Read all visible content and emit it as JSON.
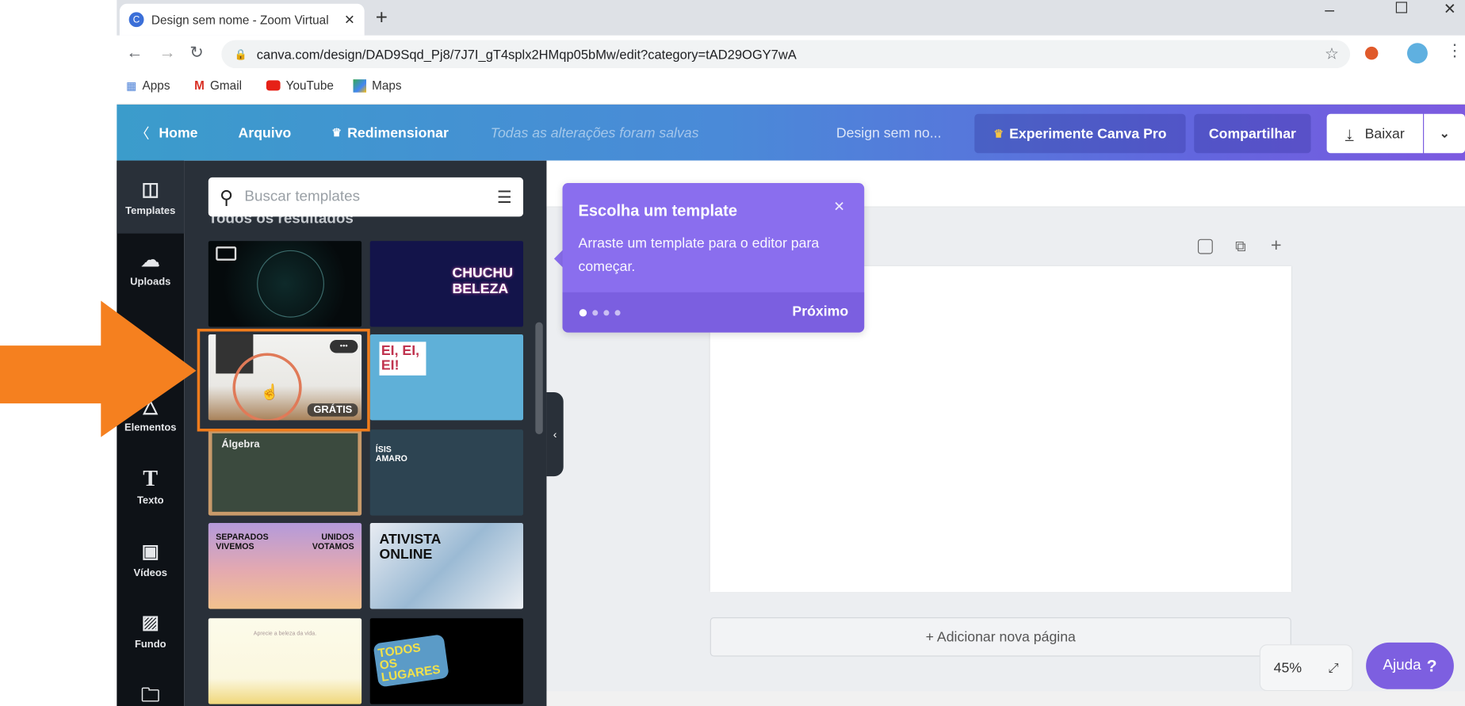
{
  "browser": {
    "tab_title": "Design sem nome - Zoom Virtual",
    "favicon_letter": "C",
    "new_tab": "+",
    "url": "canva.com/design/DAD9Sqd_Pj8/7J7I_gT4splx2HMqp05bMw/edit?category=tAD29OGY7wA",
    "bookmarks": [
      "Apps",
      "Gmail",
      "YouTube",
      "Maps"
    ]
  },
  "header": {
    "home": "Home",
    "file": "Arquivo",
    "resize": "Redimensionar",
    "status": "Todas as alterações foram salvas",
    "design_name": "Design sem no...",
    "pro": "Experimente Canva Pro",
    "share": "Compartilhar",
    "download": "Baixar"
  },
  "rail": [
    {
      "label": "Templates",
      "icon": "template-icon"
    },
    {
      "label": "Uploads",
      "icon": "upload-cloud-icon"
    },
    {
      "label": "Elementos",
      "icon": "elements-icon"
    },
    {
      "label": "Texto",
      "icon": "text-icon"
    },
    {
      "label": "Vídeos",
      "icon": "video-icon"
    },
    {
      "label": "Fundo",
      "icon": "background-icon"
    },
    {
      "label": "",
      "icon": "folder-icon"
    }
  ],
  "panel": {
    "search_placeholder": "Buscar templates",
    "heading": "Todos os resultados",
    "templates": [
      {
        "text": ""
      },
      {
        "text": "CHUCHU BELEZA"
      },
      {
        "text": "",
        "badge": "GRÁTIS",
        "more": "•••"
      },
      {
        "text": "EI, EI, EI!"
      },
      {
        "text": "Álgebra"
      },
      {
        "text": "ÍSIS AMARO"
      },
      {
        "text": "SEPARADOS VIVEMOS",
        "text2": "UNIDOS VOTAMOS"
      },
      {
        "text": "ATIVISTA ONLINE"
      },
      {
        "text": "Aprecie a beleza da vida."
      },
      {
        "text": "TODOS OS LUGARES"
      }
    ]
  },
  "tooltip": {
    "title": "Escolha um template",
    "body": "Arraste um template para o editor para começar.",
    "next": "Próximo",
    "step": 1,
    "steps": 4
  },
  "editor": {
    "add_page": "+ Adicionar nova página",
    "zoom": "45%",
    "help": "Ajuda",
    "help_icon": "?"
  },
  "colors": {
    "annotation": "#f5801f",
    "accent": "#7d5fe0"
  }
}
